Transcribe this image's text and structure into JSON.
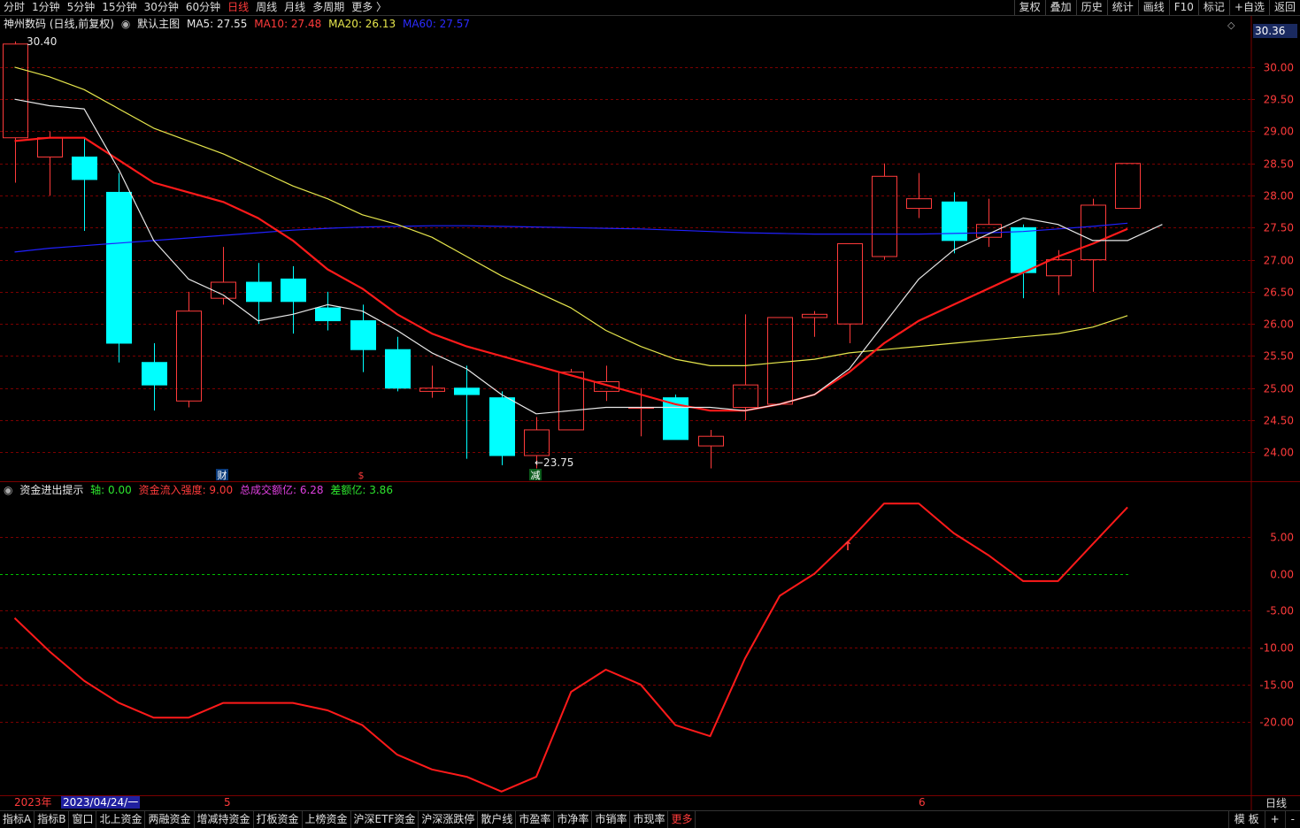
{
  "toolbar": {
    "tabs": [
      "分时",
      "1分钟",
      "5分钟",
      "15分钟",
      "30分钟",
      "60分钟",
      "日线",
      "周线",
      "月线",
      "多周期",
      "更多 〉"
    ],
    "active_tab": "日线",
    "tools": [
      "复权",
      "叠加",
      "历史",
      "统计",
      "画线",
      "F10",
      "标记",
      "+自选",
      "返回"
    ]
  },
  "main_legend": {
    "stock": "神州数码 (日线,前复权)",
    "template": "默认主图",
    "ma5": "MA5: 27.55",
    "ma10": "MA10: 27.48",
    "ma20": "MA20: 26.13",
    "ma60": "MA60: 27.57"
  },
  "sub_legend": {
    "name": "资金进出提示",
    "axis": "轴: 0.00",
    "inflow": "资金流入强度: 9.00",
    "volume": "总成交额亿: 6.28",
    "diff": "差额亿: 3.86"
  },
  "colors": {
    "up": "#ff3b3b",
    "down": "#00ffff",
    "ma5": "#e8e8e8",
    "ma10": "#ff1a1a",
    "ma20": "#e6e64c",
    "ma60": "#2020ff",
    "grid": "#7a0000",
    "zero_line": "#00c000",
    "axis_text": "#ff3b3b"
  },
  "price_axis": [
    "30.00",
    "29.50",
    "29.00",
    "28.50",
    "28.00",
    "27.50",
    "27.00",
    "26.50",
    "26.00",
    "25.50",
    "25.00",
    "24.50",
    "24.00"
  ],
  "current_price_tag": "30.36",
  "high_label": "30.40",
  "low_label": "←23.75",
  "markers": [
    "财",
    "$",
    "减"
  ],
  "indicator_axis": [
    "5.00",
    "0.00",
    "-5.00",
    "-10.00",
    "-15.00",
    "-20.00"
  ],
  "date_bar": {
    "year": "2023年",
    "cursor_date": "2023/04/24/一",
    "month5": "5",
    "month6": "6",
    "period": "日线"
  },
  "bottom_tabs": [
    "指标A",
    "指标B",
    "窗口",
    "北上资金",
    "两融资金",
    "增减持资金",
    "打板资金",
    "上榜资金",
    "沪深ETF资金",
    "沪深涨跌停",
    "散户线",
    "市盈率",
    "市净率",
    "市销率",
    "市现率",
    "更多"
  ],
  "bottom_right": [
    "模 板",
    "+",
    "-"
  ],
  "chart_data": {
    "type": "candlestick",
    "candles": [
      {
        "o": 28.9,
        "h": 30.4,
        "l": 28.2,
        "c": 30.36
      },
      {
        "o": 28.6,
        "h": 29.0,
        "l": 28.0,
        "c": 28.9
      },
      {
        "o": 28.6,
        "h": 28.9,
        "l": 27.45,
        "c": 28.25
      },
      {
        "o": 28.05,
        "h": 28.35,
        "l": 25.4,
        "c": 25.7
      },
      {
        "o": 25.4,
        "h": 25.7,
        "l": 24.65,
        "c": 25.05
      },
      {
        "o": 24.8,
        "h": 26.5,
        "l": 24.7,
        "c": 26.2
      },
      {
        "o": 26.4,
        "h": 27.2,
        "l": 26.3,
        "c": 26.65
      },
      {
        "o": 26.65,
        "h": 26.95,
        "l": 26.0,
        "c": 26.35
      },
      {
        "o": 26.7,
        "h": 26.9,
        "l": 25.85,
        "c": 26.35
      },
      {
        "o": 26.25,
        "h": 26.5,
        "l": 25.9,
        "c": 26.05
      },
      {
        "o": 26.05,
        "h": 26.3,
        "l": 25.25,
        "c": 25.6
      },
      {
        "o": 25.6,
        "h": 25.8,
        "l": 24.95,
        "c": 25.0
      },
      {
        "o": 24.95,
        "h": 25.35,
        "l": 24.85,
        "c": 25.0
      },
      {
        "o": 25.0,
        "h": 25.35,
        "l": 23.9,
        "c": 24.9
      },
      {
        "o": 24.85,
        "h": 24.95,
        "l": 23.8,
        "c": 23.95
      },
      {
        "o": 23.95,
        "h": 24.55,
        "l": 23.75,
        "c": 24.35
      },
      {
        "o": 24.35,
        "h": 25.3,
        "l": 24.35,
        "c": 25.25
      },
      {
        "o": 24.95,
        "h": 25.35,
        "l": 24.8,
        "c": 25.1
      },
      {
        "o": 24.7,
        "h": 25.0,
        "l": 24.25,
        "c": 24.7
      },
      {
        "o": 24.85,
        "h": 24.9,
        "l": 24.2,
        "c": 24.2
      },
      {
        "o": 24.1,
        "h": 24.35,
        "l": 23.75,
        "c": 24.25
      },
      {
        "o": 24.7,
        "h": 26.15,
        "l": 24.5,
        "c": 25.05
      },
      {
        "o": 24.75,
        "h": 26.1,
        "l": 24.75,
        "c": 26.1
      },
      {
        "o": 26.1,
        "h": 26.2,
        "l": 25.8,
        "c": 26.15
      },
      {
        "o": 26.0,
        "h": 27.25,
        "l": 25.7,
        "c": 27.25
      },
      {
        "o": 27.05,
        "h": 28.5,
        "l": 27.0,
        "c": 28.3
      },
      {
        "o": 27.8,
        "h": 28.35,
        "l": 27.65,
        "c": 27.95
      },
      {
        "o": 27.9,
        "h": 28.05,
        "l": 27.1,
        "c": 27.3
      },
      {
        "o": 27.35,
        "h": 27.95,
        "l": 27.2,
        "c": 27.55
      },
      {
        "o": 27.5,
        "h": 27.55,
        "l": 26.4,
        "c": 26.8
      },
      {
        "o": 26.75,
        "h": 27.15,
        "l": 26.45,
        "c": 27.0
      },
      {
        "o": 27.0,
        "h": 27.95,
        "l": 26.5,
        "c": 27.85
      },
      {
        "o": 27.8,
        "h": 28.5,
        "l": 27.8,
        "c": 28.5
      }
    ],
    "ma5": [
      29.5,
      29.4,
      29.35,
      28.4,
      27.3,
      26.7,
      26.45,
      26.05,
      26.15,
      26.3,
      26.2,
      25.9,
      25.55,
      25.3,
      24.9,
      24.6,
      24.65,
      24.7,
      24.7,
      24.7,
      24.7,
      24.65,
      24.75,
      24.9,
      25.3,
      26.0,
      26.7,
      27.15,
      27.4,
      27.65,
      27.55,
      27.3,
      27.3,
      27.55
    ],
    "ma10": [
      28.85,
      28.9,
      28.9,
      28.55,
      28.2,
      28.05,
      27.9,
      27.65,
      27.3,
      26.85,
      26.55,
      26.15,
      25.85,
      25.65,
      25.5,
      25.35,
      25.2,
      25.05,
      24.9,
      24.75,
      24.65,
      24.65,
      24.75,
      24.9,
      25.25,
      25.7,
      26.05,
      26.3,
      26.55,
      26.8,
      27.05,
      27.25,
      27.48
    ],
    "ma20": [
      30.0,
      29.85,
      29.65,
      29.35,
      29.05,
      28.85,
      28.65,
      28.4,
      28.15,
      27.95,
      27.7,
      27.55,
      27.35,
      27.05,
      26.75,
      26.5,
      26.25,
      25.9,
      25.65,
      25.45,
      25.35,
      25.35,
      25.4,
      25.45,
      25.55,
      25.6,
      25.65,
      25.7,
      25.75,
      25.8,
      25.85,
      25.95,
      26.13
    ],
    "ma60": [
      27.12,
      27.18,
      27.22,
      27.26,
      27.3,
      27.34,
      27.38,
      27.42,
      27.46,
      27.49,
      27.51,
      27.52,
      27.53,
      27.53,
      27.52,
      27.51,
      27.5,
      27.49,
      27.48,
      27.46,
      27.44,
      27.42,
      27.41,
      27.4,
      27.4,
      27.4,
      27.4,
      27.41,
      27.42,
      27.44,
      27.48,
      27.52,
      27.57
    ],
    "y_range": [
      23.55,
      30.55
    ],
    "indicator": {
      "name": "资金流入强度",
      "values": [
        -6,
        -10.5,
        -14.5,
        -17.5,
        -19.5,
        -19.5,
        -17.5,
        -17.5,
        -17.5,
        -18.5,
        -20.5,
        -24.5,
        -26.5,
        -27.5,
        -29.5,
        -27.5,
        -16,
        -13,
        -15,
        -20.5,
        -22,
        -11.5,
        -3,
        0,
        4.5,
        9.5,
        9.5,
        5.5,
        2.5,
        -1,
        -1,
        4,
        9
      ],
      "y_range": [
        -30,
        10
      ],
      "zero_line": 0
    }
  }
}
